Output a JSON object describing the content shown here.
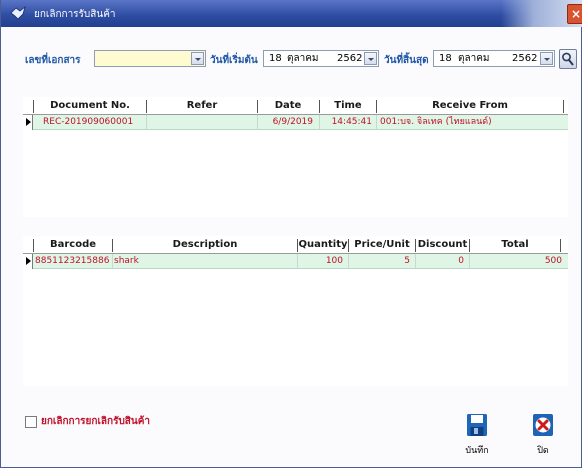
{
  "window": {
    "title": "ยกเลิกการรับสินค้า",
    "close_glyph": "×"
  },
  "filters": {
    "doc_no_label": "เลขที่เอกสาร",
    "doc_no_value": "",
    "start_label": "วันที่เริ่มต้น",
    "start_day": "18",
    "start_month": "ตุลาคม",
    "start_year": "2562",
    "end_label": "วันที่สิ้นสุด",
    "end_day": "18",
    "end_month": "ตุลาคม",
    "end_year": "2562"
  },
  "doc_grid": {
    "headers": [
      "Document No.",
      "Refer",
      "Date",
      "Time",
      "Receive From"
    ],
    "rows": [
      {
        "doc_no": "REC-201909060001",
        "refer": "",
        "date": "6/9/2019",
        "time": "14:45:41",
        "from": "001:บจ. จิลเทค (ไทยแลนด์)"
      }
    ]
  },
  "item_grid": {
    "headers": [
      "Barcode",
      "Description",
      "Quantity",
      "Price/Unit",
      "Discount",
      "Total"
    ],
    "rows": [
      {
        "barcode": "8851123215886",
        "description": "shark",
        "quantity": "100",
        "price": "5",
        "discount": "0",
        "total": "500"
      }
    ]
  },
  "footer": {
    "cancel_check_label": "ยกเลิกการยกเลิกรับสินค้า",
    "save_label": "บันทึก",
    "close_label": "ปิด"
  },
  "colors": {
    "label_blue": "#1f56a6",
    "row_text_red": "#c0102a",
    "selected_row": "#dff6e6",
    "combo_fill": "#fffbd0"
  },
  "icons": {
    "app": "window-app-icon",
    "search": "search-icon",
    "save": "floppy-disk-icon",
    "close": "red-x-icon"
  }
}
